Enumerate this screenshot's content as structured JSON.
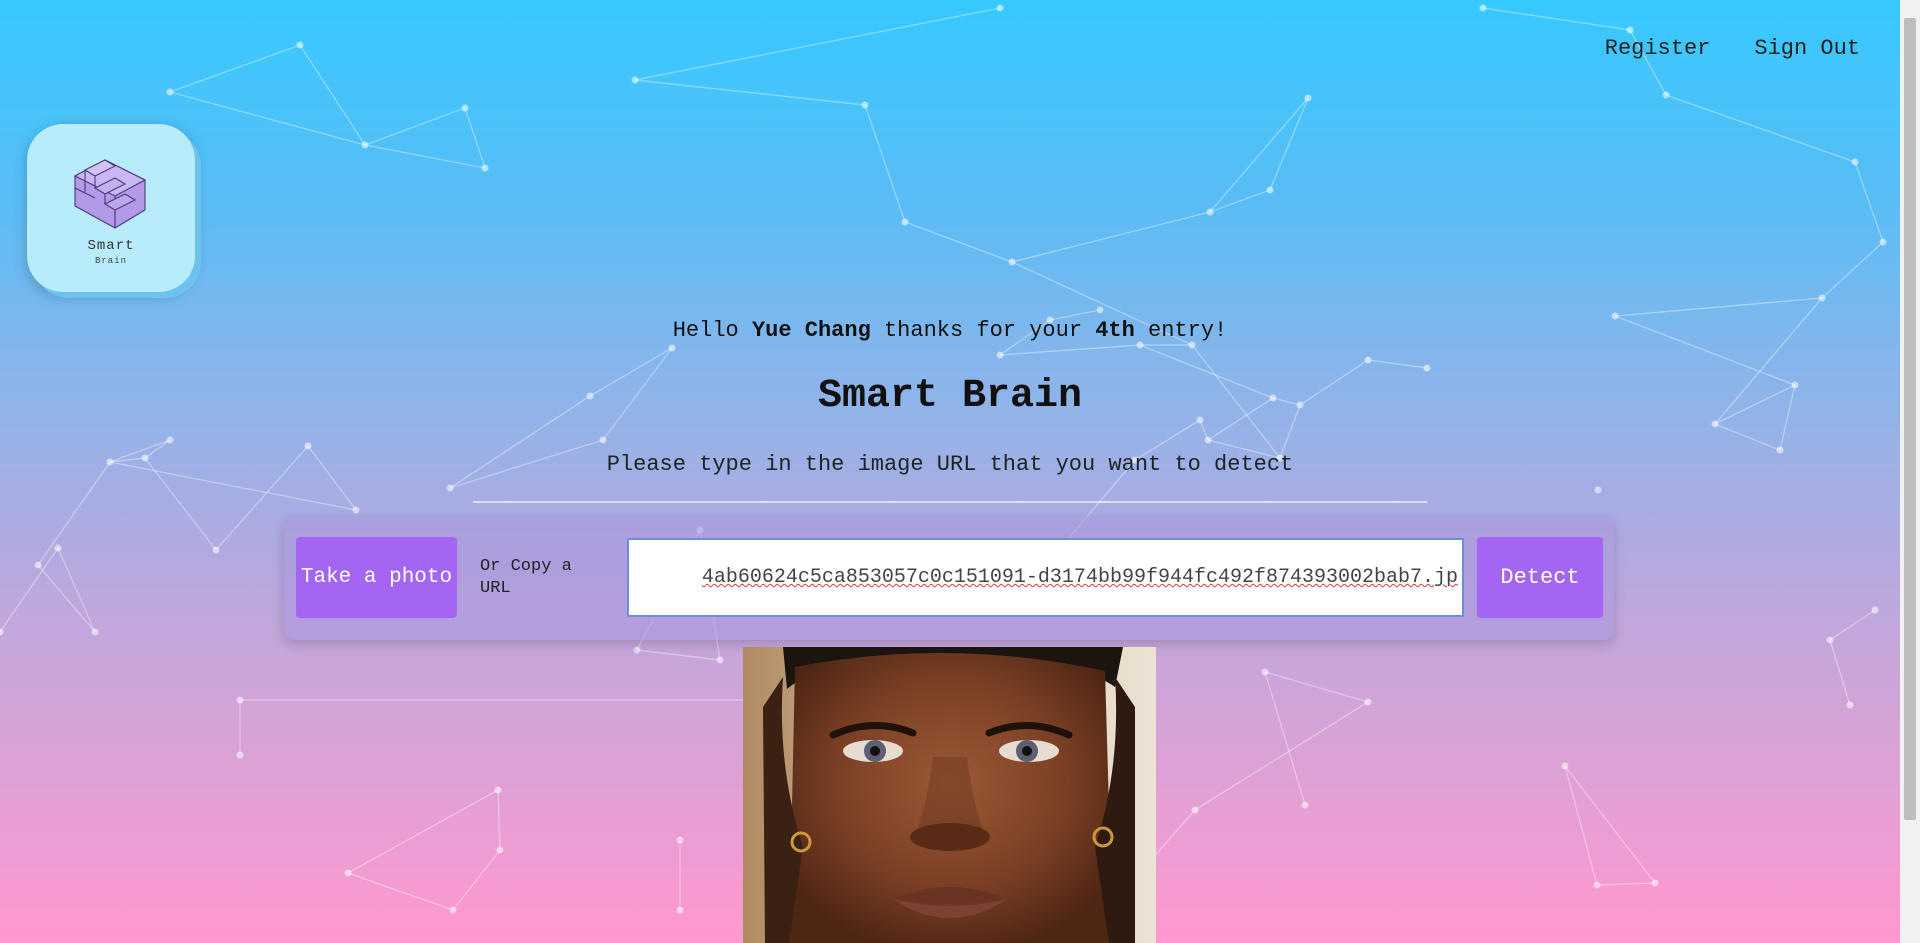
{
  "nav": {
    "register_label": "Register",
    "signout_label": "Sign Out"
  },
  "logo": {
    "name": "Smart",
    "subtitle": "Brain",
    "icon": "isometric-cube-stairs-icon"
  },
  "greeting": {
    "prefix": "Hello ",
    "user_name": "Yue Chang",
    "middle": " thanks for your ",
    "entry_rank": "4th",
    "suffix": " entry!"
  },
  "title": "Smart Brain",
  "instruction": "Please type in the image URL that you want to detect",
  "form": {
    "photo_button_label": "Take a photo",
    "or_copy_label": "Or Copy a URL",
    "url_value": "4ab60624c5ca853057c0c151091-d3174bb99f944fc492f874393002bab7.jp",
    "detect_button_label": "Detect"
  },
  "colors": {
    "gradient_top": "#36c9ff",
    "gradient_bottom": "#ff98cf",
    "accent_button": "#a465f2",
    "logo_card": "#b8ecfb"
  }
}
